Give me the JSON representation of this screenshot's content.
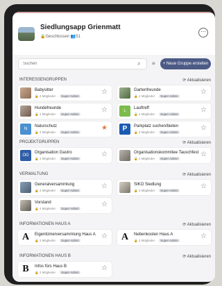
{
  "app": {
    "title": "Siedlungsapp Grienmatt",
    "meta": "🔒Geschlossen  👥51"
  },
  "toolbar": {
    "search_placeholder": "Suchen",
    "new_group_label": "+ Neue Gruppe erstellen"
  },
  "refresh_label": "⟳ Aktualisieren",
  "sections": [
    {
      "title": "INTERESSENGRUPPEN",
      "cards": [
        {
          "name": "Babysitter",
          "members": "4 Mitglieder",
          "badge": "Super Admin",
          "starred": false
        },
        {
          "name": "Gartenfreunde",
          "members": "4 Mitglieder",
          "badge": "Super Admin",
          "starred": false
        },
        {
          "name": "Hundefreunde",
          "members": "4 Mitglieder",
          "badge": "Super Admin",
          "starred": false
        },
        {
          "name": "Lauftreff",
          "members": "4 Mitglieder",
          "badge": "Super Admin",
          "starred": false
        },
        {
          "name": "Naturschutz",
          "members": "3 Mitglieder",
          "badge": "Super Admin",
          "starred": true
        },
        {
          "name": "Parkplatz suchen/bieten",
          "members": "3 Mitglieder",
          "badge": "Super Admin",
          "starred": false
        }
      ]
    },
    {
      "title": "PROJEKTGRUPPEN",
      "cards": [
        {
          "name": "Organisation Gastro",
          "members": "3 Mitglieder",
          "badge": "Super Admin",
          "starred": false
        },
        {
          "name": "Organisationskommitee Tauschfest",
          "members": "4 Mitglieder",
          "badge": "Super Admin",
          "starred": false
        }
      ]
    },
    {
      "title": "VERWALTUNG",
      "cards": [
        {
          "name": "Generalversammlung",
          "members": "3 Mitglieder",
          "badge": "Super Admin",
          "starred": false
        },
        {
          "name": "SIKO Siedlung",
          "members": "3 Mitglieder",
          "badge": "Super Admin",
          "starred": false
        },
        {
          "name": "Vorstand",
          "members": "4 Mitglieder",
          "badge": "Super Admin",
          "starred": false
        }
      ]
    },
    {
      "title": "INFORMATIONEN HAUS A",
      "cards": [
        {
          "name": "Eigentümerversammlung Haus A",
          "members": "3 Mitglieder",
          "badge": "Super Admin",
          "starred": false
        },
        {
          "name": "Nebenkosten Haus A",
          "members": "3 Mitglieder",
          "badge": "Super Admin",
          "starred": false
        }
      ]
    },
    {
      "title": "INFORMATIONEN HAUS B",
      "cards": [
        {
          "name": "Infos fürs Haus B",
          "members": "3 Mitglieder",
          "badge": "Super Admin",
          "starred": false
        }
      ]
    }
  ],
  "thumb_labels": [
    "L",
    "N",
    "P",
    "OG",
    "A",
    "A",
    "B"
  ]
}
